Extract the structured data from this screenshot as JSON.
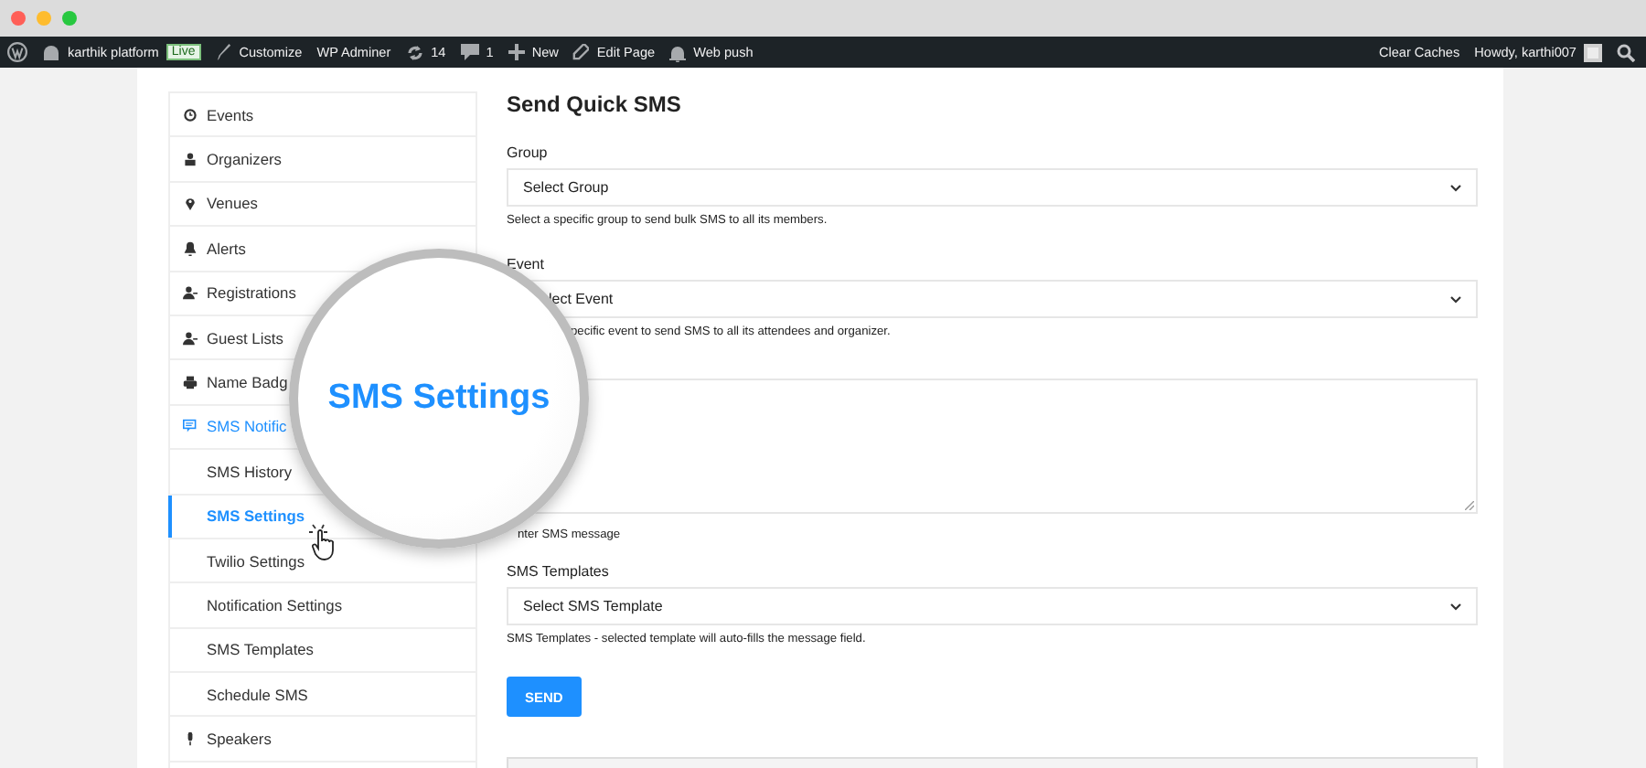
{
  "admin_bar": {
    "left": [
      {
        "kind": "logo"
      },
      {
        "kind": "site",
        "label": "karthik platform",
        "badge": "Live"
      },
      {
        "kind": "brush",
        "label": "Customize"
      },
      {
        "kind": "text",
        "label": "WP Adminer"
      },
      {
        "kind": "refresh",
        "label": "14"
      },
      {
        "kind": "comment",
        "label": "1"
      },
      {
        "kind": "plus",
        "label": "New"
      },
      {
        "kind": "pencil",
        "label": "Edit Page"
      },
      {
        "kind": "bell",
        "label": "Web push"
      }
    ],
    "right": [
      {
        "kind": "text",
        "label": "Clear Caches"
      },
      {
        "kind": "user",
        "label": "Howdy, karthi007"
      },
      {
        "kind": "search"
      }
    ]
  },
  "sidebar": {
    "items": [
      {
        "kind": "parent",
        "label": "Events",
        "selected": false
      },
      {
        "kind": "parent",
        "label": "Organizers",
        "selected": false
      },
      {
        "kind": "parent",
        "label": "Venues",
        "selected": false
      },
      {
        "kind": "parent",
        "label": "Alerts",
        "selected": false
      },
      {
        "kind": "parent",
        "label": "Registrations",
        "selected": false
      },
      {
        "kind": "parent",
        "label": "Guest Lists",
        "selected": false
      },
      {
        "kind": "parent",
        "label": "Name Badg",
        "selected": false
      },
      {
        "kind": "parent",
        "label": "SMS Notific",
        "selected": true
      },
      {
        "kind": "child",
        "label": "SMS History",
        "selected": false
      },
      {
        "kind": "child",
        "label": "SMS Settings",
        "selected": true
      },
      {
        "kind": "child",
        "label": "Twilio Settings",
        "selected": false
      },
      {
        "kind": "child",
        "label": "Notification Settings",
        "selected": false
      },
      {
        "kind": "child",
        "label": "SMS Templates",
        "selected": false
      },
      {
        "kind": "child",
        "label": "Schedule SMS",
        "selected": false
      },
      {
        "kind": "parent",
        "label": "Speakers",
        "selected": false
      }
    ]
  },
  "form": {
    "title": "Send Quick SMS",
    "fields": [
      {
        "kind": "select",
        "label": "Group",
        "value": "Select Group",
        "help": "Select a specific group to send bulk SMS to all its members."
      },
      {
        "kind": "select",
        "label": "Event",
        "value": "lect Event",
        "help": "pecific event to send SMS to all its attendees and organizer."
      },
      {
        "kind": "textarea",
        "help": "nter SMS message"
      },
      {
        "kind": "select",
        "label": "SMS Templates",
        "value": "Select SMS Template",
        "help": "SMS Templates - selected template will auto-fills the message field."
      }
    ],
    "button": "SEND"
  },
  "magnifier": {
    "text": "SMS Settings"
  }
}
